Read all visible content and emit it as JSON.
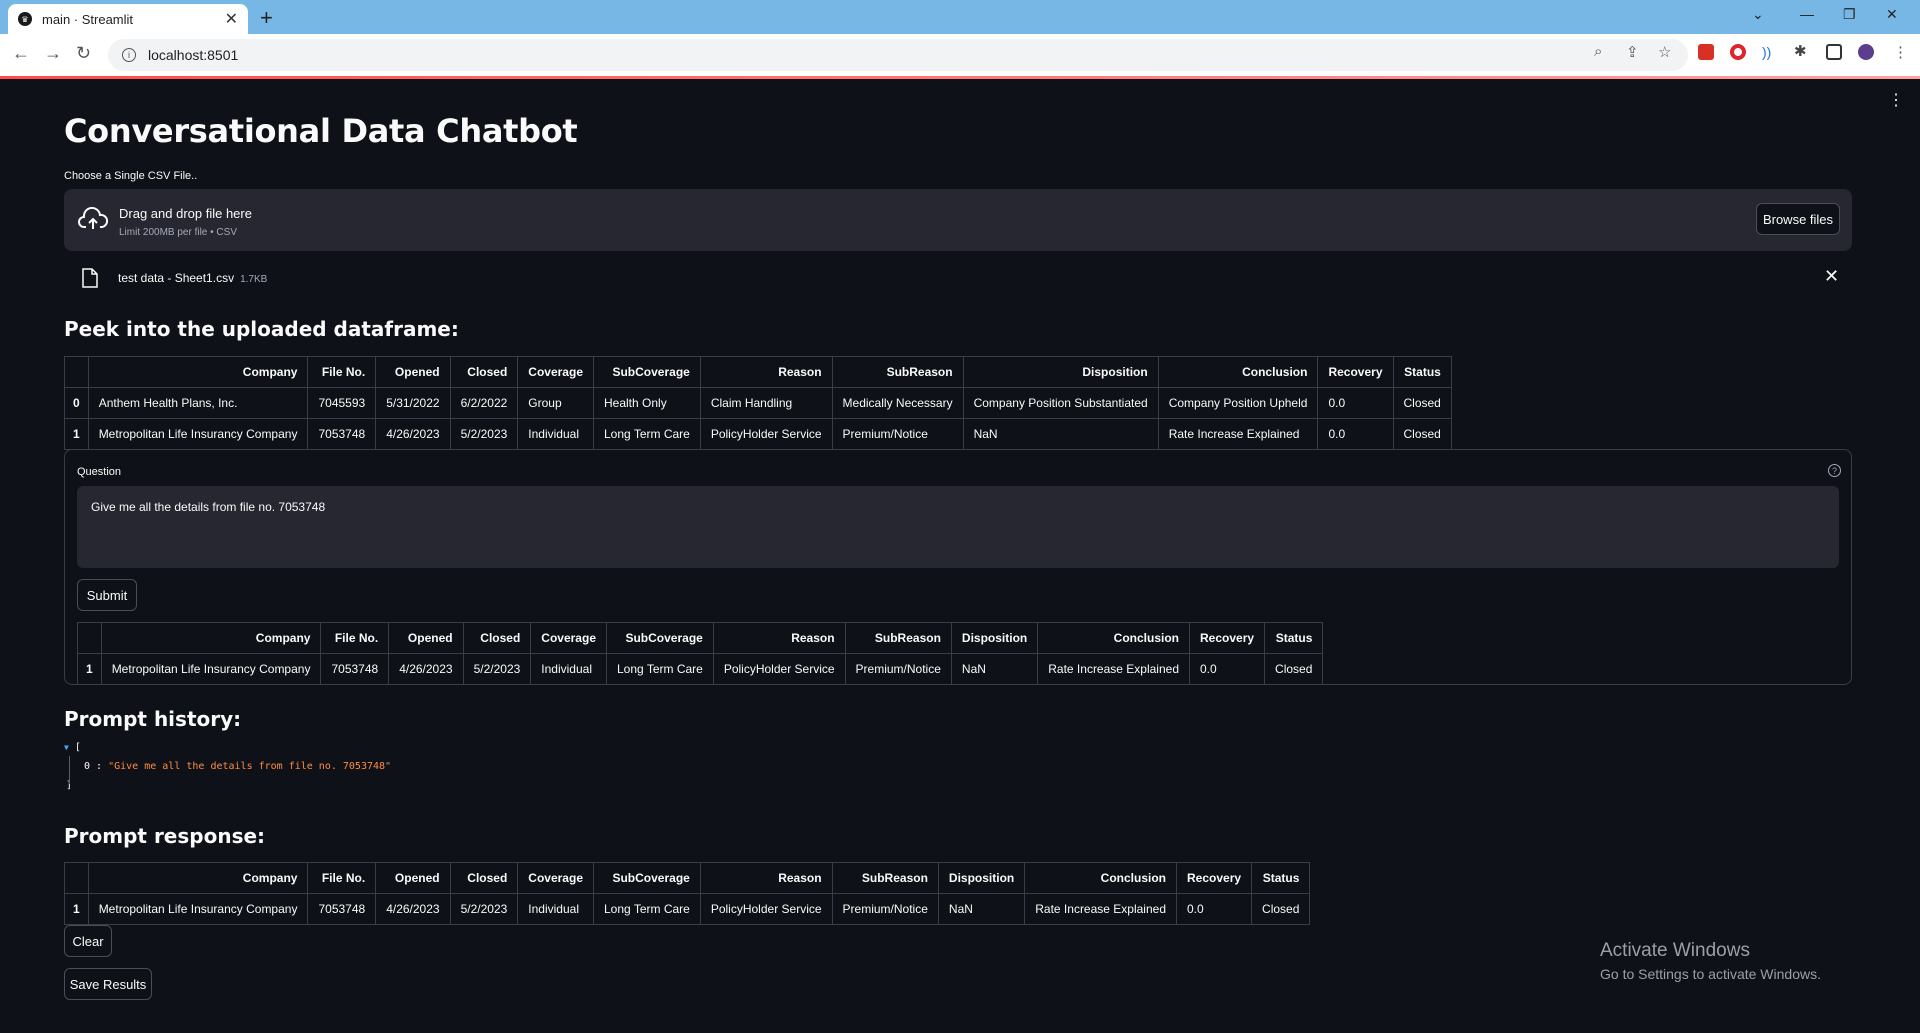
{
  "browser": {
    "tab_title": "main · Streamlit",
    "url": "localhost:8501"
  },
  "app": {
    "title": "Conversational Data Chatbot",
    "uploader": {
      "label": "Choose a Single CSV File..",
      "drag_text": "Drag and drop file here",
      "limit_text": "Limit 200MB per file • CSV",
      "browse_label": "Browse files",
      "file_name": "test data - Sheet1.csv",
      "file_size": "1.7KB"
    },
    "peek": {
      "heading": "Peek into the uploaded dataframe:",
      "columns": [
        "",
        "Company",
        "File No.",
        "Opened",
        "Closed",
        "Coverage",
        "SubCoverage",
        "Reason",
        "SubReason",
        "Disposition",
        "Conclusion",
        "Recovery",
        "Status"
      ],
      "rows": [
        [
          "0",
          "Anthem Health Plans, Inc.",
          "7045593",
          "5/31/2022",
          "6/2/2022",
          "Group",
          "Health Only",
          "Claim Handling",
          "Medically Necessary",
          "Company Position Substantiated",
          "Company Position Upheld",
          "0.0",
          "Closed"
        ],
        [
          "1",
          "Metropolitan Life Insurancy Company",
          "7053748",
          "4/26/2023",
          "5/2/2023",
          "Individual",
          "Long Term Care",
          "PolicyHolder Service",
          "Premium/Notice",
          "NaN",
          "Rate Increase Explained",
          "0.0",
          "Closed"
        ]
      ]
    },
    "form": {
      "question_label": "Question",
      "question_value": "Give me all the details from file no. 7053748",
      "submit_label": "Submit",
      "result_columns": [
        "",
        "Company",
        "File No.",
        "Opened",
        "Closed",
        "Coverage",
        "SubCoverage",
        "Reason",
        "SubReason",
        "Disposition",
        "Conclusion",
        "Recovery",
        "Status"
      ],
      "result_rows": [
        [
          "1",
          "Metropolitan Life Insurancy Company",
          "7053748",
          "4/26/2023",
          "5/2/2023",
          "Individual",
          "Long Term Care",
          "PolicyHolder Service",
          "Premium/Notice",
          "NaN",
          "Rate Increase Explained",
          "0.0",
          "Closed"
        ]
      ]
    },
    "history": {
      "heading": "Prompt history:",
      "open_bracket": "[",
      "item_index": "0 :",
      "item_value": "\"Give me all the details from file no. 7053748\"",
      "close_bracket": "]"
    },
    "response": {
      "heading": "Prompt response:",
      "columns": [
        "",
        "Company",
        "File No.",
        "Opened",
        "Closed",
        "Coverage",
        "SubCoverage",
        "Reason",
        "SubReason",
        "Disposition",
        "Conclusion",
        "Recovery",
        "Status"
      ],
      "rows": [
        [
          "1",
          "Metropolitan Life Insurancy Company",
          "7053748",
          "4/26/2023",
          "5/2/2023",
          "Individual",
          "Long Term Care",
          "PolicyHolder Service",
          "Premium/Notice",
          "NaN",
          "Rate Increase Explained",
          "0.0",
          "Closed"
        ]
      ],
      "clear_label": "Clear",
      "save_label": "Save Results"
    }
  },
  "watermark": {
    "line1": "Activate Windows",
    "line2": "Go to Settings to activate Windows."
  }
}
